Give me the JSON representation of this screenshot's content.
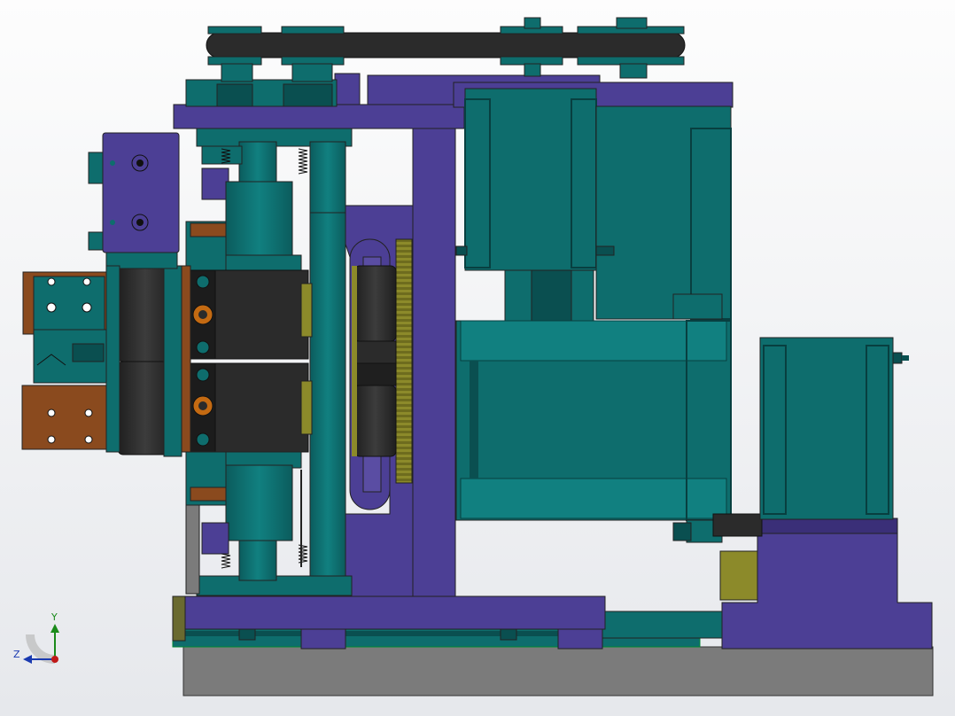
{
  "viewport": {
    "background_top": "#fdfdfd",
    "background_bottom": "#e6e8ec"
  },
  "colors": {
    "teal": "#0e6d6d",
    "teal_dark": "#0a4f50",
    "purple": "#4c3f95",
    "purple_dark": "#3a2f78",
    "brown": "#8a4a1e",
    "black": "#2b2b2b",
    "gear_olive": "#8c8a2a",
    "base_gray": "#7b7b7b",
    "accent_orange": "#c46a12"
  },
  "triad": {
    "y_label": "Y",
    "z_label": "Z",
    "icons": [
      "axis-triad-icon"
    ]
  }
}
